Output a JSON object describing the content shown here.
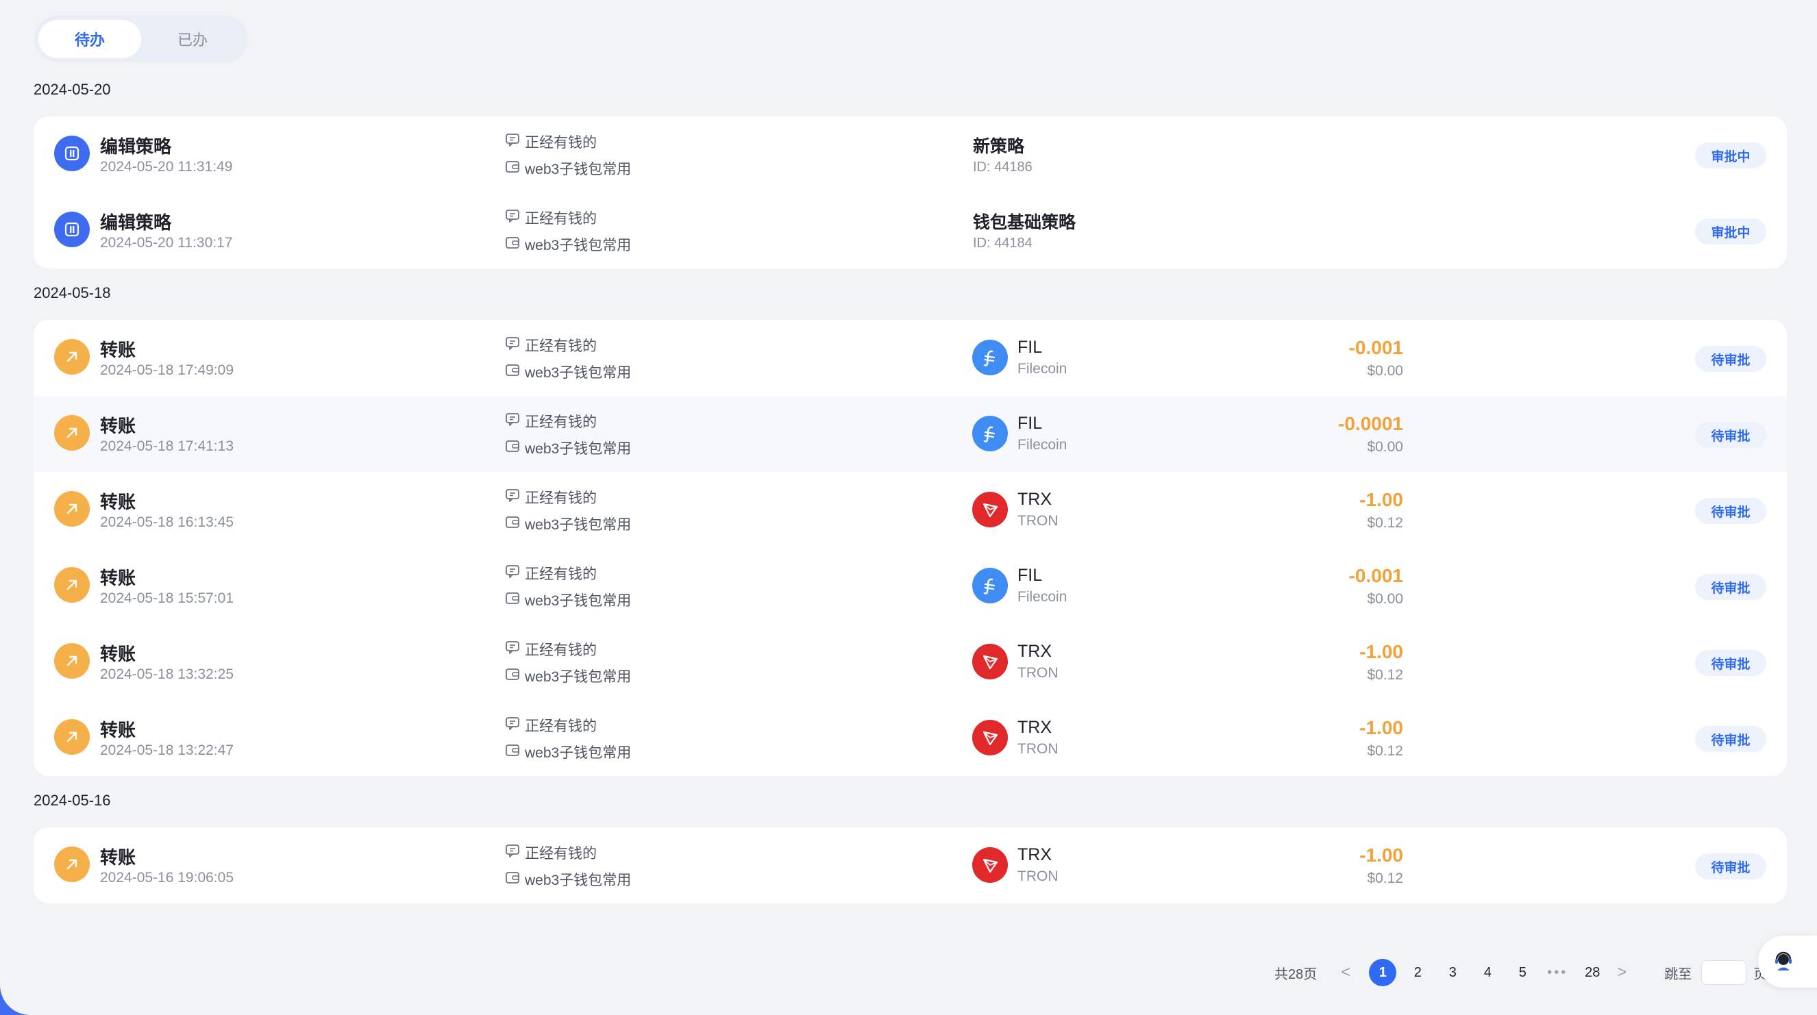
{
  "tabs": [
    {
      "label": "待办",
      "active": true
    },
    {
      "label": "已办",
      "active": false
    }
  ],
  "groups": [
    {
      "date": "2024-05-20",
      "items": [
        {
          "type": "strategy",
          "title": "编辑策略",
          "time": "2024-05-20 11:31:49",
          "team": "正经有钱的",
          "wallet": "web3子钱包常用",
          "name": "新策略",
          "id": "ID: 44186",
          "status": "审批中"
        },
        {
          "type": "strategy",
          "title": "编辑策略",
          "time": "2024-05-20 11:30:17",
          "team": "正经有钱的",
          "wallet": "web3子钱包常用",
          "name": "钱包基础策略",
          "id": "ID: 44184",
          "status": "审批中"
        }
      ]
    },
    {
      "date": "2024-05-18",
      "items": [
        {
          "type": "transfer",
          "title": "转账",
          "time": "2024-05-18 17:49:09",
          "team": "正经有钱的",
          "wallet": "web3子钱包常用",
          "coin": "fil",
          "symbol": "FIL",
          "network": "Filecoin",
          "amount": "-0.001",
          "usd": "$0.00",
          "status": "待审批"
        },
        {
          "type": "transfer",
          "title": "转账",
          "time": "2024-05-18 17:41:13",
          "team": "正经有钱的",
          "wallet": "web3子钱包常用",
          "coin": "fil",
          "symbol": "FIL",
          "network": "Filecoin",
          "amount": "-0.0001",
          "usd": "$0.00",
          "status": "待审批"
        },
        {
          "type": "transfer",
          "title": "转账",
          "time": "2024-05-18 16:13:45",
          "team": "正经有钱的",
          "wallet": "web3子钱包常用",
          "coin": "trx",
          "symbol": "TRX",
          "network": "TRON",
          "amount": "-1.00",
          "usd": "$0.12",
          "status": "待审批"
        },
        {
          "type": "transfer",
          "title": "转账",
          "time": "2024-05-18 15:57:01",
          "team": "正经有钱的",
          "wallet": "web3子钱包常用",
          "coin": "fil",
          "symbol": "FIL",
          "network": "Filecoin",
          "amount": "-0.001",
          "usd": "$0.00",
          "status": "待审批"
        },
        {
          "type": "transfer",
          "title": "转账",
          "time": "2024-05-18 13:32:25",
          "team": "正经有钱的",
          "wallet": "web3子钱包常用",
          "coin": "trx",
          "symbol": "TRX",
          "network": "TRON",
          "amount": "-1.00",
          "usd": "$0.12",
          "status": "待审批"
        },
        {
          "type": "transfer",
          "title": "转账",
          "time": "2024-05-18 13:22:47",
          "team": "正经有钱的",
          "wallet": "web3子钱包常用",
          "coin": "trx",
          "symbol": "TRX",
          "network": "TRON",
          "amount": "-1.00",
          "usd": "$0.12",
          "status": "待审批"
        }
      ]
    },
    {
      "date": "2024-05-16",
      "items": [
        {
          "type": "transfer",
          "title": "转账",
          "time": "2024-05-16 19:06:05",
          "team": "正经有钱的",
          "wallet": "web3子钱包常用",
          "coin": "trx",
          "symbol": "TRX",
          "network": "TRON",
          "amount": "-1.00",
          "usd": "$0.12",
          "status": "待审批"
        }
      ]
    }
  ],
  "pagination": {
    "total": "共28页",
    "prev_icon": "<",
    "next_icon": ">",
    "pages": [
      "1",
      "2",
      "3",
      "4",
      "5"
    ],
    "ellipsis": "•••",
    "last": "28",
    "current": "1",
    "jump_label": "跳至",
    "jump_value": "",
    "jump_unit": "页"
  },
  "icons": {
    "strategy": "strategy-icon",
    "transfer": "transfer-arrow-icon",
    "team": "chat-bubble-icon",
    "wallet": "wallet-icon",
    "fil": "filecoin-icon",
    "trx": "tron-icon",
    "support": "customer-service-icon"
  },
  "colors": {
    "accent": "#2f6bf2",
    "amount": "#f0a33a",
    "fil": "#3f8cf5",
    "trx": "#e1282b",
    "transfer": "#f5b04a"
  }
}
